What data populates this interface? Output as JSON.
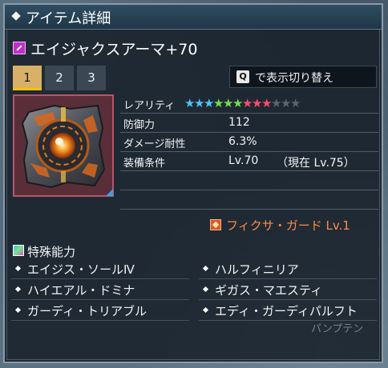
{
  "window": {
    "title": "アイテム詳細"
  },
  "item": {
    "name": "エイジャクスアーマ+70",
    "type_icon": "armor-unit-icon"
  },
  "tabs": [
    {
      "label": "1",
      "active": true
    },
    {
      "label": "2",
      "active": false
    },
    {
      "label": "3",
      "active": false
    }
  ],
  "toggle": {
    "key": "Q",
    "label": "で表示切り替え"
  },
  "stats": {
    "rarity_label": "レアリティ",
    "rarity_stars": 9,
    "rarity_max": 12,
    "rows": [
      {
        "label": "防御力",
        "value": "112",
        "extra": ""
      },
      {
        "label": "ダメージ耐性",
        "value": "6.3%",
        "extra": ""
      },
      {
        "label": "装備条件",
        "value": "Lv.70",
        "extra": "（現在 Lv.75）"
      }
    ]
  },
  "ability": {
    "label": "フィクサ・ガード Lv.1",
    "icon": "ability-icon",
    "color": "#ff8a48"
  },
  "special": {
    "title": "特殊能力",
    "items": [
      "エイジス・ソールⅣ",
      "ハルフィニリア",
      "ハイエアル・ドミナ",
      "ギガス・マエスティ",
      "ガーディ・トリアブル",
      "エディ・ガーディパルフト"
    ]
  },
  "watermark": "パンプテン",
  "colors": {
    "star_blue": "#4cc4f0",
    "star_green": "#6fe04c",
    "star_red": "#ff4a6e",
    "star_empty": "#5a6470",
    "tab_active": "#d8b068"
  }
}
